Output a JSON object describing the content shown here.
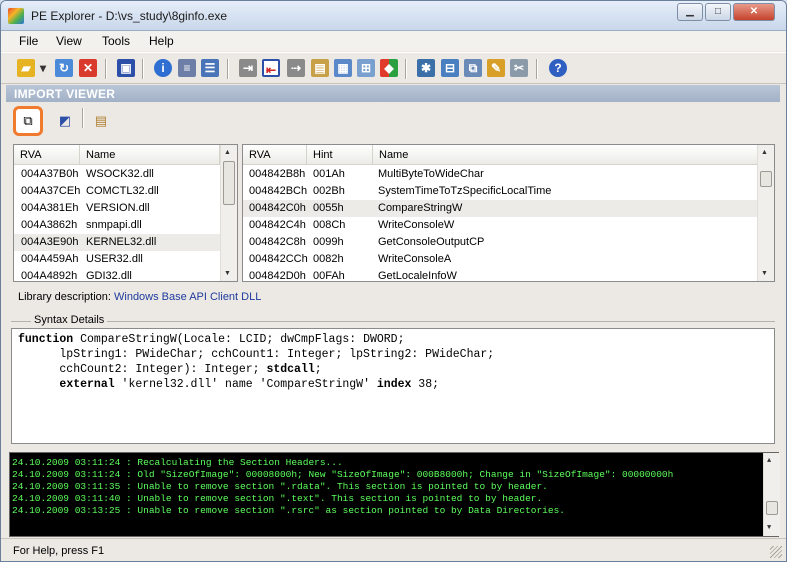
{
  "window": {
    "title": "PE Explorer - D:\\vs_study\\8ginfo.exe"
  },
  "menu": [
    "File",
    "View",
    "Tools",
    "Help"
  ],
  "section": {
    "title": "IMPORT VIEWER"
  },
  "libs": {
    "headers": [
      "RVA",
      "Name"
    ],
    "rows": [
      {
        "rva": "004A37B0h",
        "name": "WSOCK32.dll"
      },
      {
        "rva": "004A37CEh",
        "name": "COMCTL32.dll"
      },
      {
        "rva": "004A381Eh",
        "name": "VERSION.dll"
      },
      {
        "rva": "004A3862h",
        "name": "snmpapi.dll"
      },
      {
        "rva": "004A3E90h",
        "name": "KERNEL32.dll",
        "selected": true
      },
      {
        "rva": "004A459Ah",
        "name": "USER32.dll"
      },
      {
        "rva": "004A4892h",
        "name": "GDI32.dll"
      }
    ]
  },
  "funcs": {
    "headers": [
      "RVA",
      "Hint",
      "Name"
    ],
    "rows": [
      {
        "rva": "004842B8h",
        "hint": "001Ah",
        "name": "MultiByteToWideChar"
      },
      {
        "rva": "004842BCh",
        "hint": "002Bh",
        "name": "SystemTimeToTzSpecificLocalTime"
      },
      {
        "rva": "004842C0h",
        "hint": "0055h",
        "name": "CompareStringW",
        "selected": true
      },
      {
        "rva": "004842C4h",
        "hint": "008Ch",
        "name": "WriteConsoleW"
      },
      {
        "rva": "004842C8h",
        "hint": "0099h",
        "name": "GetConsoleOutputCP"
      },
      {
        "rva": "004842CCh",
        "hint": "0082h",
        "name": "WriteConsoleA"
      },
      {
        "rva": "004842D0h",
        "hint": "00FAh",
        "name": "GetLocaleInfoW"
      }
    ]
  },
  "library_description": {
    "label": "Library description:",
    "value": "Windows Base API Client DLL"
  },
  "syntax": {
    "label": "Syntax Details",
    "lines": [
      "function CompareStringW(Locale: LCID; dwCmpFlags: DWORD;",
      "      lpString1: PWideChar; cchCount1: Integer; lpString2: PWideChar;",
      "      cchCount2: Integer): Integer; stdcall;",
      "      external 'kernel32.dll' name 'CompareStringW' index 38;"
    ]
  },
  "log": [
    "24.10.2009 03:11:24 : Recalculating the Section Headers...",
    "24.10.2009 03:11:24 : Old \"SizeOfImage\": 00008000h; New \"SizeOfImage\": 000B8000h; Change in \"SizeOfImage\": 00000000h",
    "24.10.2009 03:11:35 : Unable to remove section \".rdata\". This section is pointed to by header.",
    "24.10.2009 03:11:40 : Unable to remove section \".text\". This section is pointed to by header.",
    "24.10.2009 03:13:25 : Unable to remove section \".rsrc\" as section pointed to by Data Directories."
  ],
  "status": {
    "text": "For Help, press F1"
  },
  "colors": {
    "highlight": "#f07a2e",
    "log_text": "#5dff5d",
    "header_band": "#a2b1c6"
  }
}
